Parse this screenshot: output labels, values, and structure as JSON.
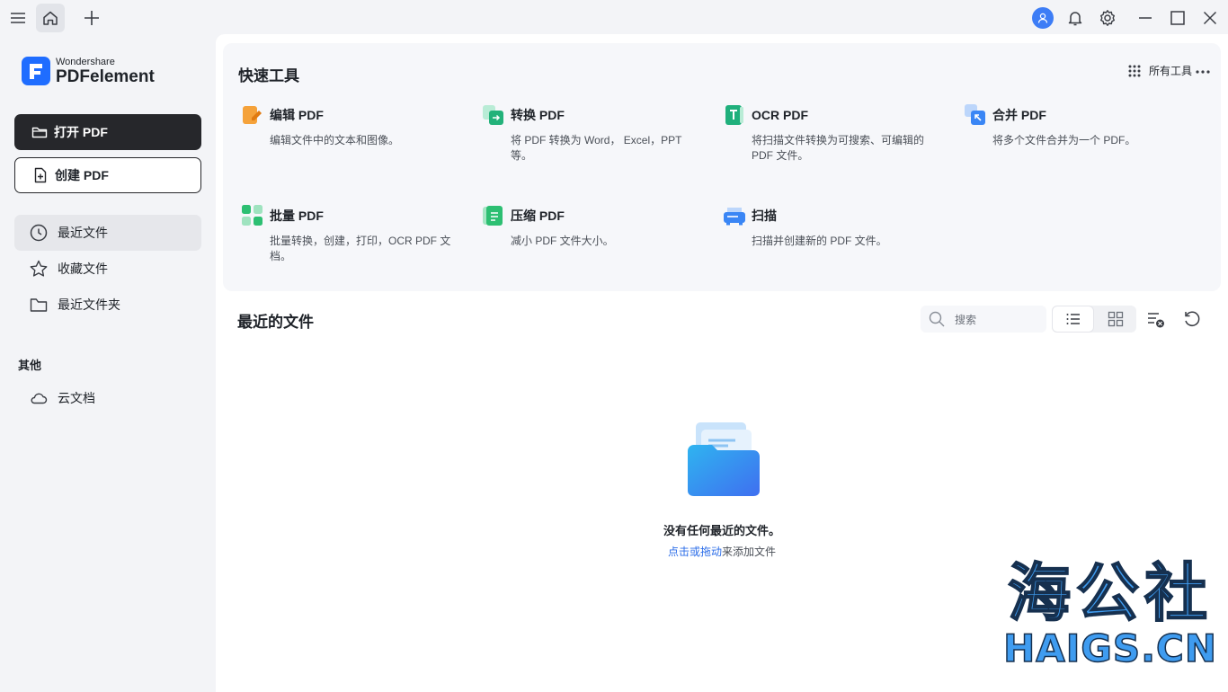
{
  "titlebar": {
    "menu_icon": "hamburger-icon",
    "home_icon": "home-icon",
    "new_tab_icon": "plus-icon",
    "icons": [
      "avatar-icon",
      "bell-icon",
      "gear-icon",
      "minimize-icon",
      "maximize-icon",
      "close-icon"
    ]
  },
  "sidebar": {
    "logo_small": "Wondershare",
    "logo_big": "PDFelement",
    "open_label": "打开 PDF",
    "create_label": "创建 PDF",
    "nav": [
      {
        "label": "最近文件",
        "icon": "clock-icon"
      },
      {
        "label": "收藏文件",
        "icon": "star-icon"
      },
      {
        "label": "最近文件夹",
        "icon": "folder-icon"
      }
    ],
    "section_other": "其他",
    "cloud_label": "云文档"
  },
  "quick_tools": {
    "title": "快速工具",
    "all_tools": "所有工具",
    "items": [
      {
        "name": "编辑 PDF",
        "desc": "编辑文件中的文本和图像。",
        "color": "#f08a24"
      },
      {
        "name": "转换 PDF",
        "desc": "将 PDF 转换为 Word， Excel，PPT 等。",
        "color": "#23b27a"
      },
      {
        "name": "OCR PDF",
        "desc": "将扫描文件转换为可搜索、可编辑的 PDF 文件。",
        "color": "#20b07c"
      },
      {
        "name": "合并 PDF",
        "desc": "将多个文件合并为一个 PDF。",
        "color": "#3a86f5"
      },
      {
        "name": "批量 PDF",
        "desc": "批量转换，创建，打印，OCR PDF 文档。",
        "color": "#2dbf72"
      },
      {
        "name": "压缩 PDF",
        "desc": "减小 PDF 文件大小。",
        "color": "#2dbf72"
      },
      {
        "name": "扫描",
        "desc": "扫描并创建新的 PDF 文件。",
        "color": "#3a86f5"
      }
    ]
  },
  "recent": {
    "title": "最近的文件",
    "search_placeholder": "搜索",
    "empty_title": "没有任何最近的文件。",
    "empty_link": "点击或拖动",
    "empty_rest": "来添加文件"
  },
  "watermark": {
    "cn": "海公社",
    "en": "HAIGS.CN"
  }
}
